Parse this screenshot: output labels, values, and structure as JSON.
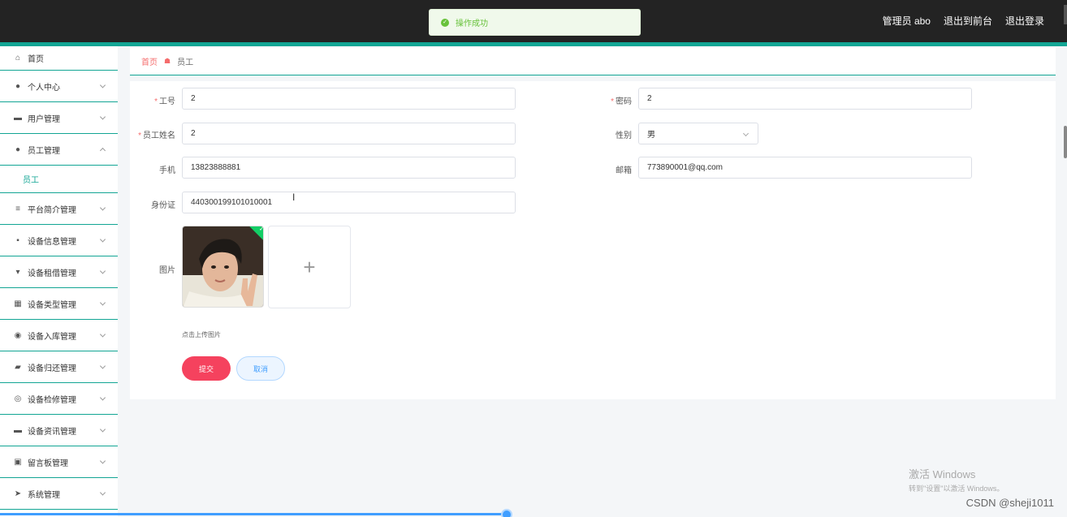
{
  "topbar": {
    "admin_label": "管理员 abo",
    "front_label": "退出到前台",
    "logout_label": "退出登录"
  },
  "toast": {
    "icon": "check-circle-icon",
    "text": "操作成功"
  },
  "sidebar": {
    "items": [
      {
        "label": "首页",
        "icon": "home-icon"
      },
      {
        "label": "个人中心",
        "icon": "user-icon"
      },
      {
        "label": "用户管理",
        "icon": "id-card-icon"
      },
      {
        "label": "员工管理",
        "icon": "user-icon"
      },
      {
        "label": "平台简介管理",
        "icon": "list-icon"
      },
      {
        "label": "设备信息管理",
        "icon": "message-icon"
      },
      {
        "label": "设备租借管理",
        "icon": "signpost-icon"
      },
      {
        "label": "设备类型管理",
        "icon": "grid-icon"
      },
      {
        "label": "设备入库管理",
        "icon": "microphone-icon"
      },
      {
        "label": "设备归还管理",
        "icon": "briefcase-icon"
      },
      {
        "label": "设备检修管理",
        "icon": "compass-icon"
      },
      {
        "label": "设备资讯管理",
        "icon": "monitor-icon"
      },
      {
        "label": "留言板管理",
        "icon": "clipboard-icon"
      },
      {
        "label": "系统管理",
        "icon": "send-icon"
      }
    ],
    "submenu": {
      "label": "员工"
    }
  },
  "breadcrumb": {
    "home": "首页",
    "current": "员工"
  },
  "form": {
    "employee_no": {
      "label": "工号",
      "value": "2"
    },
    "password": {
      "label": "密码",
      "value": "2"
    },
    "employee_name": {
      "label": "员工姓名",
      "value": "2"
    },
    "gender": {
      "label": "性别",
      "value": "男"
    },
    "phone": {
      "label": "手机",
      "value": "13823888881"
    },
    "email": {
      "label": "邮箱",
      "value": "773890001@qq.com"
    },
    "id_card": {
      "label": "身份证",
      "value": "440300199101010001"
    },
    "photo": {
      "label": "图片",
      "upload_icon": "plus-icon",
      "tip": "点击上传图片"
    },
    "submit_label": "提交",
    "cancel_label": "取消"
  },
  "watermark": {
    "line1": "激活 Windows",
    "line2": "转到\"设置\"以激活 Windows。",
    "csdn": "CSDN @sheji1011"
  }
}
